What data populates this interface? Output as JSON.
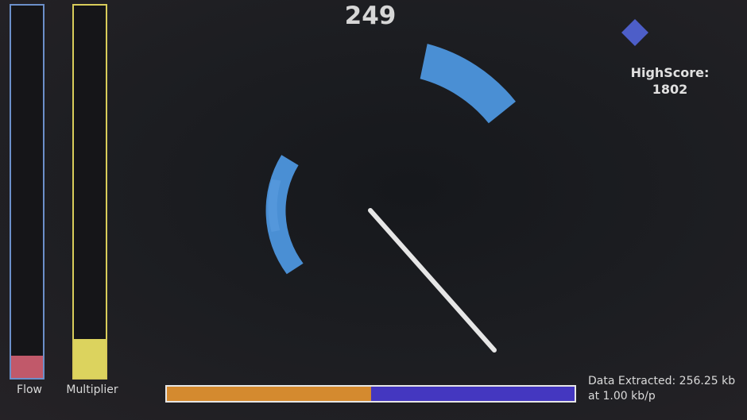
{
  "score": "249",
  "highscore": {
    "label": "HighScore:",
    "value": "1802"
  },
  "meters": {
    "flow": {
      "label": "Flow",
      "level": 0.06,
      "color": "#c1596a"
    },
    "multiplier": {
      "label": "Multiplier",
      "level": 0.105,
      "color": "#dcd35e"
    }
  },
  "extraction": {
    "progress": 0.5,
    "line1": "Data Extracted: 256.25 kb",
    "line2": "at 1.00 kb/p"
  },
  "colors": {
    "arc": "#4a8fd4",
    "needle": "#e6e6e6",
    "gem": "#4d5ec8"
  },
  "icons": {
    "gem": "diamond-icon"
  }
}
